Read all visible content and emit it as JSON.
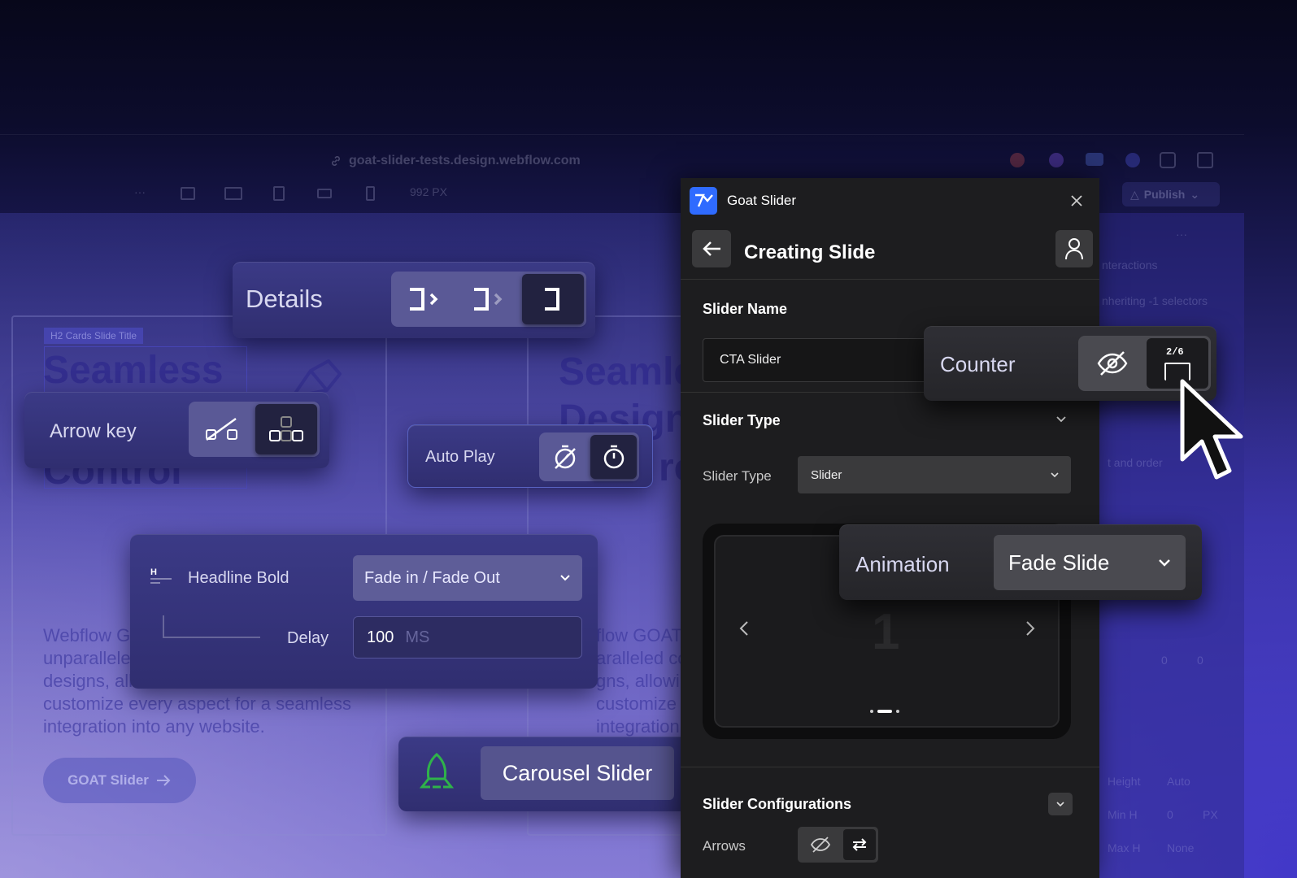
{
  "browser": {
    "url": "goat-slider-tests.design.webflow.com",
    "width_readout": "992 PX",
    "publish_label": "Publish"
  },
  "canvas": {
    "tag_label": "H2 Cards Slide Title",
    "card1_heading_lines": [
      "Seamless",
      "Control"
    ],
    "card2_heading_lines": [
      "Seamle",
      "Design",
      "ro"
    ],
    "card1_body_lines": [
      "Webflow G",
      "unparallele",
      "designs, all",
      "customize every aspect for a seamless",
      "integration into any website."
    ],
    "card2_body_lines": [
      "flow GOAT",
      "aralleled co",
      "gns, allowi",
      "customize ever",
      "integration int"
    ],
    "goat_button_label": "GOAT Slider"
  },
  "right_panel_ghost": {
    "interactions": "nteractions",
    "inheriting": "nheriting -1 selectors",
    "order": "t and order",
    "height_label": "Height",
    "height_value": "Auto",
    "min_h_label": "Min H",
    "min_h_value": "0",
    "min_h_unit": "PX",
    "max_h_label": "Max H",
    "max_h_value": "None",
    "zero": "0"
  },
  "floating": {
    "details_label": "Details",
    "arrow_key_label": "Arrow key",
    "auto_play_label": "Auto Play",
    "headline_label": "Headline Bold",
    "headline_select": "Fade in / Fade Out",
    "delay_label": "Delay",
    "delay_value": "100",
    "delay_unit": "MS",
    "carousel_label": "Carousel Slider",
    "counter_label": "Counter",
    "counter_icon_text": "2/6",
    "animation_label": "Animation",
    "animation_value": "Fade Slide"
  },
  "panel": {
    "app_name": "Goat Slider",
    "title": "Creating Slide",
    "slider_name_heading": "Slider Name",
    "slider_name_value": "CTA Slider",
    "slider_type_heading": "Slider Type",
    "slider_type_label": "Slider Type",
    "slider_type_value": "Slider",
    "preview_number": "1",
    "configurations_heading": "Slider Configurations",
    "arrows_label": "Arrows"
  },
  "colors": {
    "accent_green": "#2fb34a",
    "panel_bg": "#1d1d1f",
    "app_icon_blue": "#2f6bff"
  }
}
